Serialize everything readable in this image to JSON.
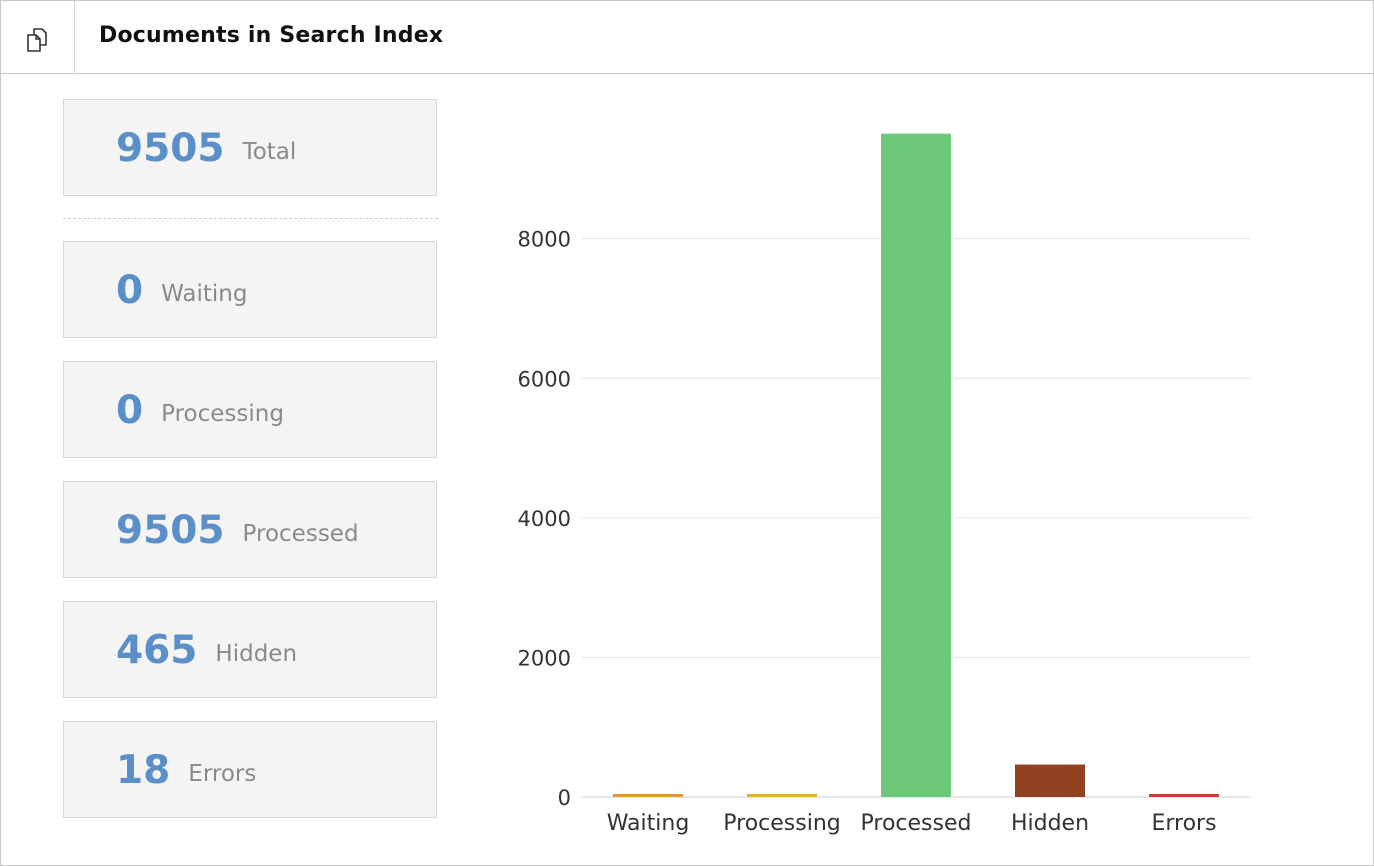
{
  "header": {
    "title": "Documents in Search Index",
    "icon": "documents-icon"
  },
  "stats": [
    {
      "value": "9505",
      "label": "Total"
    },
    {
      "value": "0",
      "label": "Waiting"
    },
    {
      "value": "0",
      "label": "Processing"
    },
    {
      "value": "9505",
      "label": "Processed"
    },
    {
      "value": "465",
      "label": "Hidden"
    },
    {
      "value": "18",
      "label": "Errors"
    }
  ],
  "colors": {
    "accent": "#5b8fc7"
  },
  "chart_data": {
    "type": "bar",
    "categories": [
      "Waiting",
      "Processing",
      "Processed",
      "Hidden",
      "Errors"
    ],
    "values": [
      0,
      0,
      9505,
      465,
      18
    ],
    "colors": [
      "#e8962f",
      "#e0b43a",
      "#6cc97a",
      "#904322",
      "#c0432f"
    ],
    "ylim": [
      0,
      9600
    ],
    "yticks": [
      0,
      2000,
      4000,
      6000,
      8000
    ],
    "grid": true
  }
}
